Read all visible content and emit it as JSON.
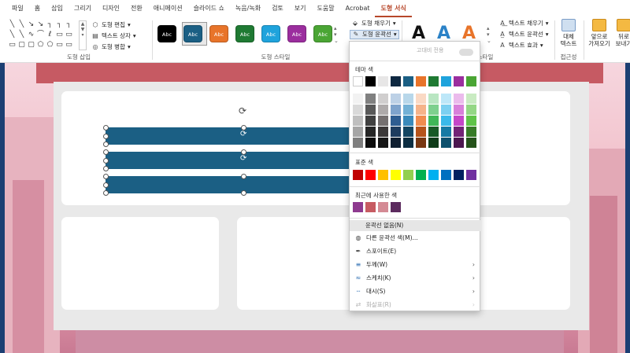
{
  "tabs": [
    "파일",
    "홈",
    "삽입",
    "그리기",
    "디자인",
    "전환",
    "애니메이션",
    "슬라이드 쇼",
    "녹음/녹화",
    "검토",
    "보기",
    "도움말",
    "Acrobat",
    "도형 서식"
  ],
  "ribbon": {
    "insert_shapes_label": "도형 삽입",
    "edit_shape": "도형 편집",
    "text_box": "텍스트 상자",
    "merge_shapes": "도형 병합",
    "shape_styles_label": "도형 스타일",
    "style_thumb_text": "Abc",
    "shape_fill": "도형 채우기",
    "shape_outline": "도형 윤곽선",
    "text_fill": "텍스트 채우기",
    "text_outline": "텍스트 윤곽선",
    "text_effects": "텍스트 효과",
    "wordart_styles_label": "스타일",
    "alt_text": "대체\n텍스트",
    "accessibility_label": "접근성",
    "bring_forward": "앞으로\n가져오기",
    "send_backward": "뒤로\n보내기",
    "styles": [
      {
        "bg": "#000000"
      },
      {
        "bg": "#1b5f84"
      },
      {
        "bg": "#e8742a"
      },
      {
        "bg": "#1f7a33"
      },
      {
        "bg": "#1fa3dc"
      },
      {
        "bg": "#9b2e9e"
      },
      {
        "bg": "#4aa534"
      }
    ],
    "wordart": [
      {
        "letter": "A",
        "color": "#111111"
      },
      {
        "letter": "A",
        "color": "#2b82c7"
      },
      {
        "letter": "A",
        "color": "#e8742a"
      }
    ]
  },
  "dropdown": {
    "auto_ink": "고대비 전용",
    "theme_colors_label": "테마 색",
    "theme_top": [
      "#ffffff",
      "#000000",
      "#e7e6e6",
      "#0e2841",
      "#1b5f84",
      "#e8742a",
      "#1f7a33",
      "#1fa3dc",
      "#9b2e9e",
      "#4aa534"
    ],
    "theme_tints": [
      [
        "#f2f2f2",
        "#808080",
        "#d0cece",
        "#bdd1e6",
        "#b8d7ea",
        "#fad9c4",
        "#b9e6c2",
        "#bde7f8",
        "#ebbbec",
        "#c9ebc2"
      ],
      [
        "#d9d9d9",
        "#595959",
        "#aeaaaa",
        "#7ea3cc",
        "#73b1d6",
        "#f5b38a",
        "#7dd08e",
        "#7cd0f1",
        "#d880da",
        "#94d785"
      ],
      [
        "#bfbfbf",
        "#404040",
        "#757070",
        "#2e5d91",
        "#3a8abb",
        "#f08c4f",
        "#3fb758",
        "#3ab9ea",
        "#c547c8",
        "#5fc348"
      ],
      [
        "#a6a6a6",
        "#262626",
        "#3b3838",
        "#1d3c5f",
        "#144663",
        "#b6531a",
        "#175a26",
        "#157aa4",
        "#732276",
        "#377b27"
      ],
      [
        "#7f7f7f",
        "#0d0d0d",
        "#161616",
        "#0f1f31",
        "#0d2e42",
        "#793711",
        "#0f3c19",
        "#0e516e",
        "#4c174f",
        "#25521a"
      ]
    ],
    "standard_label": "표준 색",
    "standard": [
      "#c00000",
      "#ff0000",
      "#ffc000",
      "#ffff00",
      "#92d050",
      "#00b050",
      "#00b0f0",
      "#0070c0",
      "#002060",
      "#7030a0"
    ],
    "recent_label": "최근에 사용한 색",
    "recent": [
      "#8e3a8f",
      "#c75b62",
      "#d48a94",
      "#5c2b5e"
    ],
    "no_outline": "윤곽선 없음(N)",
    "more_colors": "다른 윤곽선 색(M)...",
    "eyedropper": "스포이트(E)",
    "weight": "두께(W)",
    "sketched": "스케치(K)",
    "dashes": "대시(S)",
    "arrows": "화살표(R)"
  }
}
